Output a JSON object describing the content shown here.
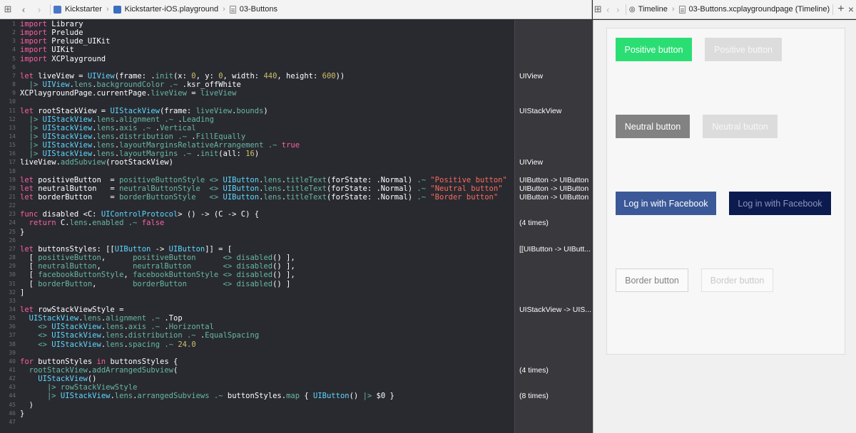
{
  "left_jumpbar": {
    "crumbs": [
      "Kickstarter",
      "Kickstarter-iOS.playground",
      "03-Buttons"
    ]
  },
  "right_jumpbar": {
    "crumbs": [
      "Timeline",
      "03-Buttons.xcplaygroundpage (Timeline)"
    ],
    "add_label": "+",
    "close_label": "×"
  },
  "editor": {
    "line_count": 47,
    "lines": [
      [
        [
          "kw",
          "import"
        ],
        [
          "pl",
          " Library"
        ]
      ],
      [
        [
          "kw",
          "import"
        ],
        [
          "pl",
          " Prelude"
        ]
      ],
      [
        [
          "kw",
          "import"
        ],
        [
          "pl",
          " Prelude_UIKit"
        ]
      ],
      [
        [
          "kw",
          "import"
        ],
        [
          "pl",
          " UIKit"
        ]
      ],
      [
        [
          "kw",
          "import"
        ],
        [
          "pl",
          " XCPlayground"
        ]
      ],
      [],
      [
        [
          "kw",
          "let"
        ],
        [
          "pl",
          " liveView = "
        ],
        [
          "ty",
          "UIView"
        ],
        [
          "pl",
          "(frame: ."
        ],
        [
          "fn",
          "init"
        ],
        [
          "pl",
          "(x: "
        ],
        [
          "nu",
          "0"
        ],
        [
          "pl",
          ", y: "
        ],
        [
          "nu",
          "0"
        ],
        [
          "pl",
          ", width: "
        ],
        [
          "nu",
          "440"
        ],
        [
          "pl",
          ", height: "
        ],
        [
          "nu",
          "600"
        ],
        [
          "pl",
          "))"
        ]
      ],
      [
        [
          "pl",
          "  "
        ],
        [
          "fn",
          "|>"
        ],
        [
          "pl",
          " "
        ],
        [
          "ty",
          "UIView"
        ],
        [
          "pl",
          "."
        ],
        [
          "fn",
          "lens"
        ],
        [
          "pl",
          "."
        ],
        [
          "fn",
          "backgroundColor"
        ],
        [
          "pl",
          " "
        ],
        [
          "fn",
          ".~"
        ],
        [
          "pl",
          " .ksr_offWhite"
        ]
      ],
      [
        [
          "pl",
          "XCPlaygroundPage.currentPage."
        ],
        [
          "fn",
          "liveView"
        ],
        [
          "pl",
          " = "
        ],
        [
          "fn",
          "liveView"
        ]
      ],
      [],
      [
        [
          "kw",
          "let"
        ],
        [
          "pl",
          " rootStackView = "
        ],
        [
          "ty",
          "UIStackView"
        ],
        [
          "pl",
          "(frame: "
        ],
        [
          "fn",
          "liveView"
        ],
        [
          "pl",
          "."
        ],
        [
          "fn",
          "bounds"
        ],
        [
          "pl",
          ")"
        ]
      ],
      [
        [
          "pl",
          "  "
        ],
        [
          "fn",
          "|>"
        ],
        [
          "pl",
          " "
        ],
        [
          "ty",
          "UIStackView"
        ],
        [
          "pl",
          "."
        ],
        [
          "fn",
          "lens"
        ],
        [
          "pl",
          "."
        ],
        [
          "fn",
          "alignment"
        ],
        [
          "pl",
          " "
        ],
        [
          "fn",
          ".~"
        ],
        [
          "pl",
          " ."
        ],
        [
          "fn",
          "Leading"
        ]
      ],
      [
        [
          "pl",
          "  "
        ],
        [
          "fn",
          "|>"
        ],
        [
          "pl",
          " "
        ],
        [
          "ty",
          "UIStackView"
        ],
        [
          "pl",
          "."
        ],
        [
          "fn",
          "lens"
        ],
        [
          "pl",
          "."
        ],
        [
          "fn",
          "axis"
        ],
        [
          "pl",
          " "
        ],
        [
          "fn",
          ".~"
        ],
        [
          "pl",
          " ."
        ],
        [
          "fn",
          "Vertical"
        ]
      ],
      [
        [
          "pl",
          "  "
        ],
        [
          "fn",
          "|>"
        ],
        [
          "pl",
          " "
        ],
        [
          "ty",
          "UIStackView"
        ],
        [
          "pl",
          "."
        ],
        [
          "fn",
          "lens"
        ],
        [
          "pl",
          "."
        ],
        [
          "fn",
          "distribution"
        ],
        [
          "pl",
          " "
        ],
        [
          "fn",
          ".~"
        ],
        [
          "pl",
          " ."
        ],
        [
          "fn",
          "FillEqually"
        ]
      ],
      [
        [
          "pl",
          "  "
        ],
        [
          "fn",
          "|>"
        ],
        [
          "pl",
          " "
        ],
        [
          "ty",
          "UIStackView"
        ],
        [
          "pl",
          "."
        ],
        [
          "fn",
          "lens"
        ],
        [
          "pl",
          "."
        ],
        [
          "fn",
          "layoutMarginsRelativeArrangement"
        ],
        [
          "pl",
          " "
        ],
        [
          "fn",
          ".~"
        ],
        [
          "pl",
          " "
        ],
        [
          "kw",
          "true"
        ]
      ],
      [
        [
          "pl",
          "  "
        ],
        [
          "fn",
          "|>"
        ],
        [
          "pl",
          " "
        ],
        [
          "ty",
          "UIStackView"
        ],
        [
          "pl",
          "."
        ],
        [
          "fn",
          "lens"
        ],
        [
          "pl",
          "."
        ],
        [
          "fn",
          "layoutMargins"
        ],
        [
          "pl",
          " "
        ],
        [
          "fn",
          ".~"
        ],
        [
          "pl",
          " ."
        ],
        [
          "fn",
          "init"
        ],
        [
          "pl",
          "(all: "
        ],
        [
          "nu",
          "16"
        ],
        [
          "pl",
          ")"
        ]
      ],
      [
        [
          "pl",
          "liveView."
        ],
        [
          "fn",
          "addSubview"
        ],
        [
          "pl",
          "(rootStackView)"
        ]
      ],
      [],
      [
        [
          "kw",
          "let"
        ],
        [
          "pl",
          " positiveButton  = "
        ],
        [
          "fn",
          "positiveButtonStyle"
        ],
        [
          "pl",
          " "
        ],
        [
          "fn",
          "<>"
        ],
        [
          "pl",
          " "
        ],
        [
          "ty",
          "UIButton"
        ],
        [
          "pl",
          "."
        ],
        [
          "fn",
          "lens"
        ],
        [
          "pl",
          "."
        ],
        [
          "fn",
          "titleText"
        ],
        [
          "pl",
          "(forState: .Normal) "
        ],
        [
          "fn",
          ".~"
        ],
        [
          "pl",
          " "
        ],
        [
          "st",
          "\"Positive button\""
        ]
      ],
      [
        [
          "kw",
          "let"
        ],
        [
          "pl",
          " neutralButton   = "
        ],
        [
          "fn",
          "neutralButtonStyle"
        ],
        [
          "pl",
          "  "
        ],
        [
          "fn",
          "<>"
        ],
        [
          "pl",
          " "
        ],
        [
          "ty",
          "UIButton"
        ],
        [
          "pl",
          "."
        ],
        [
          "fn",
          "lens"
        ],
        [
          "pl",
          "."
        ],
        [
          "fn",
          "titleText"
        ],
        [
          "pl",
          "(forState: .Normal) "
        ],
        [
          "fn",
          ".~"
        ],
        [
          "pl",
          " "
        ],
        [
          "st",
          "\"Neutral button\""
        ]
      ],
      [
        [
          "kw",
          "let"
        ],
        [
          "pl",
          " borderButton    = "
        ],
        [
          "fn",
          "borderButtonStyle"
        ],
        [
          "pl",
          "   "
        ],
        [
          "fn",
          "<>"
        ],
        [
          "pl",
          " "
        ],
        [
          "ty",
          "UIButton"
        ],
        [
          "pl",
          "."
        ],
        [
          "fn",
          "lens"
        ],
        [
          "pl",
          "."
        ],
        [
          "fn",
          "titleText"
        ],
        [
          "pl",
          "(forState: .Normal) "
        ],
        [
          "fn",
          ".~"
        ],
        [
          "pl",
          " "
        ],
        [
          "st",
          "\"Border button\""
        ]
      ],
      [],
      [
        [
          "kw",
          "func"
        ],
        [
          "pl",
          " disabled <C: "
        ],
        [
          "ty",
          "UIControlProtocol"
        ],
        [
          "pl",
          "> () -> (C -> C) {"
        ]
      ],
      [
        [
          "pl",
          "  "
        ],
        [
          "kw",
          "return"
        ],
        [
          "pl",
          " C."
        ],
        [
          "fn",
          "lens"
        ],
        [
          "pl",
          "."
        ],
        [
          "fn",
          "enabled"
        ],
        [
          "pl",
          " "
        ],
        [
          "fn",
          ".~"
        ],
        [
          "pl",
          " "
        ],
        [
          "kw",
          "false"
        ]
      ],
      [
        [
          "pl",
          "}"
        ]
      ],
      [],
      [
        [
          "kw",
          "let"
        ],
        [
          "pl",
          " buttonsStyles: [["
        ],
        [
          "ty",
          "UIButton"
        ],
        [
          "pl",
          " -> "
        ],
        [
          "ty",
          "UIButton"
        ],
        [
          "pl",
          "]] = ["
        ]
      ],
      [
        [
          "pl",
          "  [ "
        ],
        [
          "fn",
          "positiveButton"
        ],
        [
          "pl",
          ",      "
        ],
        [
          "fn",
          "positiveButton"
        ],
        [
          "pl",
          "      "
        ],
        [
          "fn",
          "<>"
        ],
        [
          "pl",
          " "
        ],
        [
          "fn",
          "disabled"
        ],
        [
          "pl",
          "() ],"
        ]
      ],
      [
        [
          "pl",
          "  [ "
        ],
        [
          "fn",
          "neutralButton"
        ],
        [
          "pl",
          ",       "
        ],
        [
          "fn",
          "neutralButton"
        ],
        [
          "pl",
          "       "
        ],
        [
          "fn",
          "<>"
        ],
        [
          "pl",
          " "
        ],
        [
          "fn",
          "disabled"
        ],
        [
          "pl",
          "() ],"
        ]
      ],
      [
        [
          "pl",
          "  [ "
        ],
        [
          "fn",
          "facebookButtonStyle"
        ],
        [
          "pl",
          ", "
        ],
        [
          "fn",
          "facebookButtonStyle"
        ],
        [
          "pl",
          " "
        ],
        [
          "fn",
          "<>"
        ],
        [
          "pl",
          " "
        ],
        [
          "fn",
          "disabled"
        ],
        [
          "pl",
          "() ],"
        ]
      ],
      [
        [
          "pl",
          "  [ "
        ],
        [
          "fn",
          "borderButton"
        ],
        [
          "pl",
          ",        "
        ],
        [
          "fn",
          "borderButton"
        ],
        [
          "pl",
          "        "
        ],
        [
          "fn",
          "<>"
        ],
        [
          "pl",
          " "
        ],
        [
          "fn",
          "disabled"
        ],
        [
          "pl",
          "() ]"
        ]
      ],
      [
        [
          "pl",
          "]"
        ]
      ],
      [],
      [
        [
          "kw",
          "let"
        ],
        [
          "pl",
          " rowStackViewStyle ="
        ]
      ],
      [
        [
          "pl",
          "  "
        ],
        [
          "ty",
          "UIStackView"
        ],
        [
          "pl",
          "."
        ],
        [
          "fn",
          "lens"
        ],
        [
          "pl",
          "."
        ],
        [
          "fn",
          "alignment"
        ],
        [
          "pl",
          " "
        ],
        [
          "fn",
          ".~"
        ],
        [
          "pl",
          " .Top"
        ]
      ],
      [
        [
          "pl",
          "    "
        ],
        [
          "fn",
          "<>"
        ],
        [
          "pl",
          " "
        ],
        [
          "ty",
          "UIStackView"
        ],
        [
          "pl",
          "."
        ],
        [
          "fn",
          "lens"
        ],
        [
          "pl",
          "."
        ],
        [
          "fn",
          "axis"
        ],
        [
          "pl",
          " "
        ],
        [
          "fn",
          ".~"
        ],
        [
          "pl",
          " ."
        ],
        [
          "fn",
          "Horizontal"
        ]
      ],
      [
        [
          "pl",
          "    "
        ],
        [
          "fn",
          "<>"
        ],
        [
          "pl",
          " "
        ],
        [
          "ty",
          "UIStackView"
        ],
        [
          "pl",
          "."
        ],
        [
          "fn",
          "lens"
        ],
        [
          "pl",
          "."
        ],
        [
          "fn",
          "distribution"
        ],
        [
          "pl",
          " "
        ],
        [
          "fn",
          ".~"
        ],
        [
          "pl",
          " ."
        ],
        [
          "fn",
          "EqualSpacing"
        ]
      ],
      [
        [
          "pl",
          "    "
        ],
        [
          "fn",
          "<>"
        ],
        [
          "pl",
          " "
        ],
        [
          "ty",
          "UIStackView"
        ],
        [
          "pl",
          "."
        ],
        [
          "fn",
          "lens"
        ],
        [
          "pl",
          "."
        ],
        [
          "fn",
          "spacing"
        ],
        [
          "pl",
          " "
        ],
        [
          "fn",
          ".~"
        ],
        [
          "pl",
          " "
        ],
        [
          "nu",
          "24.0"
        ]
      ],
      [],
      [
        [
          "kw",
          "for"
        ],
        [
          "pl",
          " buttonStyles "
        ],
        [
          "kw",
          "in"
        ],
        [
          "pl",
          " buttonsStyles {"
        ]
      ],
      [
        [
          "pl",
          "  "
        ],
        [
          "fn",
          "rootStackView"
        ],
        [
          "pl",
          "."
        ],
        [
          "fn",
          "addArrangedSubview"
        ],
        [
          "pl",
          "("
        ]
      ],
      [
        [
          "pl",
          "    "
        ],
        [
          "ty",
          "UIStackView"
        ],
        [
          "pl",
          "()"
        ]
      ],
      [
        [
          "pl",
          "      "
        ],
        [
          "fn",
          "|>"
        ],
        [
          "pl",
          " "
        ],
        [
          "fn",
          "rowStackViewStyle"
        ]
      ],
      [
        [
          "pl",
          "      "
        ],
        [
          "fn",
          "|>"
        ],
        [
          "pl",
          " "
        ],
        [
          "ty",
          "UIStackView"
        ],
        [
          "pl",
          "."
        ],
        [
          "fn",
          "lens"
        ],
        [
          "pl",
          "."
        ],
        [
          "fn",
          "arrangedSubviews"
        ],
        [
          "pl",
          " "
        ],
        [
          "fn",
          ".~"
        ],
        [
          "pl",
          " buttonStyles."
        ],
        [
          "fn",
          "map"
        ],
        [
          "pl",
          " { "
        ],
        [
          "ty",
          "UIButton"
        ],
        [
          "pl",
          "() "
        ],
        [
          "fn",
          "|>"
        ],
        [
          "pl",
          " $0 }"
        ]
      ],
      [
        [
          "pl",
          "  )"
        ]
      ],
      [
        [
          "pl",
          "}"
        ]
      ],
      []
    ]
  },
  "results": [
    {
      "line": 7,
      "text": "UIView"
    },
    {
      "line": 11,
      "text": "UIStackView"
    },
    {
      "line": 17,
      "text": "UIView"
    },
    {
      "line": 19,
      "text": "UIButton -> UIButton"
    },
    {
      "line": 20,
      "text": "UIButton -> UIButton"
    },
    {
      "line": 21,
      "text": "UIButton -> UIButton"
    },
    {
      "line": 24,
      "text": "(4 times)"
    },
    {
      "line": 27,
      "text": "[[UIButton -> UIButt..."
    },
    {
      "line": 34,
      "text": "UIStackView -> UIS..."
    },
    {
      "line": 41,
      "text": "(4 times)"
    },
    {
      "line": 44,
      "text": "(8 times)"
    }
  ],
  "live_view": {
    "buttons": [
      {
        "label": "Positive button",
        "style": "pos"
      },
      {
        "label": "Positive button",
        "style": "pos-dis"
      },
      {
        "label": "Neutral button",
        "style": "neu"
      },
      {
        "label": "Neutral button",
        "style": "neu-dis"
      },
      {
        "label": "Log in with Facebook",
        "style": "fb"
      },
      {
        "label": "Log in with Facebook",
        "style": "fb-dis"
      },
      {
        "label": "Border button",
        "style": "brd"
      },
      {
        "label": "Border button",
        "style": "brd-dis"
      }
    ]
  }
}
